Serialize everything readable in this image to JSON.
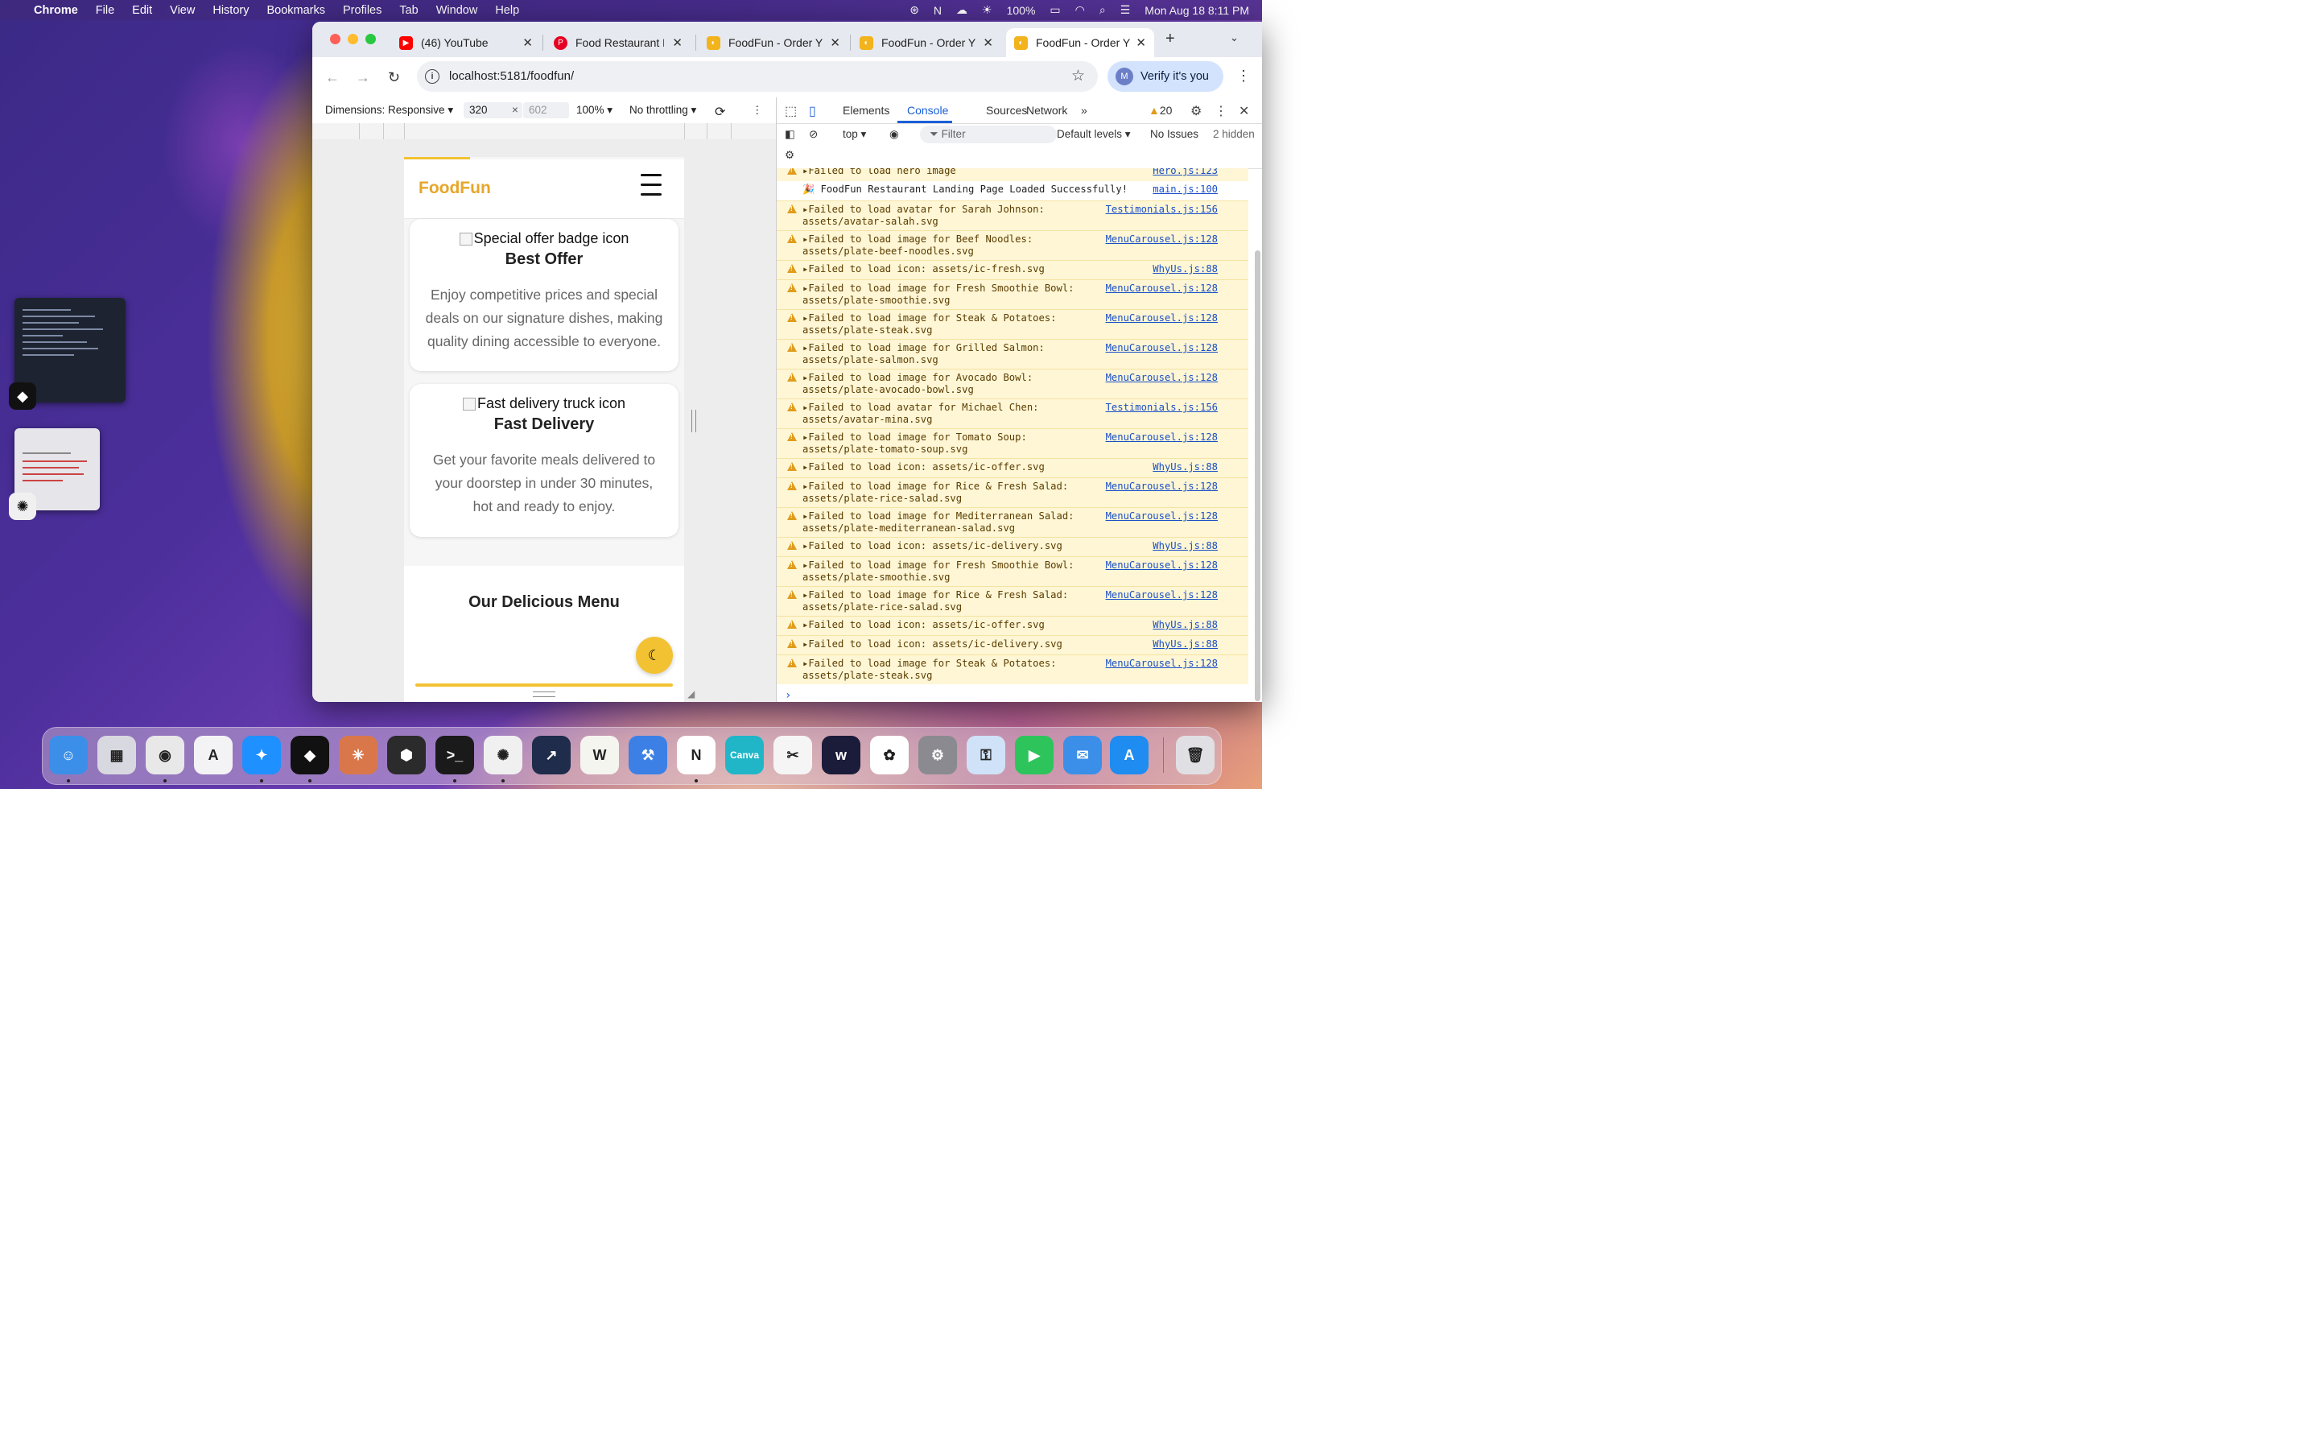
{
  "menubar": {
    "app": "Chrome",
    "items": [
      "File",
      "Edit",
      "View",
      "History",
      "Bookmarks",
      "Profiles",
      "Tab",
      "Window",
      "Help"
    ],
    "battery": "100%",
    "datetime": "Mon Aug 18  8:11 PM"
  },
  "tabs": [
    {
      "title": "(46) YouTube",
      "icon": "youtube-icon",
      "color": "#ff0000"
    },
    {
      "title": "Food Restaurant P",
      "icon": "pinterest-icon",
      "color": "#e60023"
    },
    {
      "title": "FoodFun - Order Y",
      "icon": "foodfun-icon",
      "color": "#f2b31c"
    },
    {
      "title": "FoodFun - Order Y",
      "icon": "foodfun-icon",
      "color": "#f2b31c"
    },
    {
      "title": "FoodFun - Order Y",
      "icon": "foodfun-icon",
      "color": "#f2b31c"
    }
  ],
  "address": {
    "url": "localhost:5181/foodfun/"
  },
  "profile": {
    "initial": "M",
    "label": "Verify it's you"
  },
  "device_toolbar": {
    "dimensions": "Dimensions: Responsive",
    "width": "320",
    "height": "602",
    "zoom": "100%",
    "throttling": "No throttling"
  },
  "page": {
    "logo": "FoodFun",
    "cards": [
      {
        "alt": "Special offer badge icon",
        "title": "Best Offer",
        "text": "Enjoy competitive prices and special deals on our signature dishes, making quality dining accessible to everyone."
      },
      {
        "alt": "Fast delivery truck icon",
        "title": "Fast Delivery",
        "text": "Get your favorite meals delivered to your doorstep in under 30 minutes, hot and ready to enjoy."
      }
    ],
    "menu_heading": "Our Delicious Menu"
  },
  "devtools": {
    "tabs": [
      "Elements",
      "Console",
      "Sources",
      "Network"
    ],
    "active_tab": "Console",
    "warning_count": "20",
    "context": "top",
    "filter_placeholder": "Filter",
    "levels": "Default levels",
    "issues": "No Issues",
    "hidden": "2 hidden"
  },
  "console": [
    {
      "type": "warn",
      "msg": "Failed to load hero image",
      "src": "Hero.js:123",
      "partial": true
    },
    {
      "type": "info",
      "msg": "🎉 FoodFun Restaurant Landing Page Loaded Successfully!",
      "src": "main.js:100"
    },
    {
      "type": "warn",
      "msg": "Failed to load avatar for Sarah Johnson:\nassets/avatar-salah.svg",
      "src": "Testimonials.js:156"
    },
    {
      "type": "warn",
      "msg": "Failed to load image for Beef Noodles:\nassets/plate-beef-noodles.svg",
      "src": "MenuCarousel.js:128"
    },
    {
      "type": "warn",
      "msg": "Failed to load icon: assets/ic-fresh.svg",
      "src": "WhyUs.js:88"
    },
    {
      "type": "warn",
      "msg": "Failed to load image for Fresh Smoothie Bowl:\nassets/plate-smoothie.svg",
      "src": "MenuCarousel.js:128"
    },
    {
      "type": "warn",
      "msg": "Failed to load image for Steak & Potatoes:\nassets/plate-steak.svg",
      "src": "MenuCarousel.js:128"
    },
    {
      "type": "warn",
      "msg": "Failed to load image for Grilled Salmon:\nassets/plate-salmon.svg",
      "src": "MenuCarousel.js:128"
    },
    {
      "type": "warn",
      "msg": "Failed to load image for Avocado Bowl:\nassets/plate-avocado-bowl.svg",
      "src": "MenuCarousel.js:128"
    },
    {
      "type": "warn",
      "msg": "Failed to load avatar for Michael Chen:\nassets/avatar-mina.svg",
      "src": "Testimonials.js:156"
    },
    {
      "type": "warn",
      "msg": "Failed to load image for Tomato Soup:\nassets/plate-tomato-soup.svg",
      "src": "MenuCarousel.js:128"
    },
    {
      "type": "warn",
      "msg": "Failed to load icon: assets/ic-offer.svg",
      "src": "WhyUs.js:88"
    },
    {
      "type": "warn",
      "msg": "Failed to load image for Rice & Fresh Salad:\nassets/plate-rice-salad.svg",
      "src": "MenuCarousel.js:128"
    },
    {
      "type": "warn",
      "msg": "Failed to load image for Mediterranean Salad:\nassets/plate-mediterranean-salad.svg",
      "src": "MenuCarousel.js:128"
    },
    {
      "type": "warn",
      "msg": "Failed to load icon: assets/ic-delivery.svg",
      "src": "WhyUs.js:88"
    },
    {
      "type": "warn",
      "msg": "Failed to load image for Fresh Smoothie Bowl:\nassets/plate-smoothie.svg",
      "src": "MenuCarousel.js:128"
    },
    {
      "type": "warn",
      "msg": "Failed to load image for Rice & Fresh Salad:\nassets/plate-rice-salad.svg",
      "src": "MenuCarousel.js:128"
    },
    {
      "type": "warn",
      "msg": "Failed to load icon: assets/ic-offer.svg",
      "src": "WhyUs.js:88"
    },
    {
      "type": "warn",
      "msg": "Failed to load icon: assets/ic-delivery.svg",
      "src": "WhyUs.js:88"
    },
    {
      "type": "warn",
      "msg": "Failed to load image for Steak & Potatoes:\nassets/plate-steak.svg",
      "src": "MenuCarousel.js:128"
    }
  ],
  "dock": [
    {
      "name": "finder-icon",
      "color": "#3b8fe8",
      "glyph": "☺",
      "dot": true
    },
    {
      "name": "launchpad-icon",
      "color": "#d8d8e0",
      "glyph": "▦",
      "dot": false
    },
    {
      "name": "chrome-icon",
      "color": "#e8e8e8",
      "glyph": "◉",
      "dot": true
    },
    {
      "name": "affinity-icon",
      "color": "#f3f3f6",
      "glyph": "A",
      "dot": false
    },
    {
      "name": "safari-icon",
      "color": "#1e90ff",
      "glyph": "✦",
      "dot": true
    },
    {
      "name": "cube-app-icon",
      "color": "#111111",
      "glyph": "◆",
      "dot": true
    },
    {
      "name": "claude-icon",
      "color": "#d9774b",
      "glyph": "✳",
      "dot": false
    },
    {
      "name": "3d-box-icon",
      "color": "#2b2b2b",
      "glyph": "⬢",
      "dot": false
    },
    {
      "name": "terminal-icon",
      "color": "#1a1a1a",
      "glyph": ">_",
      "dot": true
    },
    {
      "name": "chatgpt-icon",
      "color": "#f0f0f0",
      "glyph": "✺",
      "dot": true
    },
    {
      "name": "devtool-icon",
      "color": "#1f2c4c",
      "glyph": "↗",
      "dot": false
    },
    {
      "name": "writer-icon",
      "color": "#f5f5f0",
      "glyph": "W",
      "dot": false
    },
    {
      "name": "xcode-icon",
      "color": "#3c80e6",
      "glyph": "⚒",
      "dot": false
    },
    {
      "name": "notion-icon",
      "color": "#ffffff",
      "glyph": "N",
      "dot": true
    },
    {
      "name": "canva-icon",
      "color": "#20b6c8",
      "glyph": "Canva",
      "dot": false
    },
    {
      "name": "capcut-icon",
      "color": "#f5f5f5",
      "glyph": "✂",
      "dot": false
    },
    {
      "name": "webflow-icon",
      "color": "#1b1b3a",
      "glyph": "w",
      "dot": false
    },
    {
      "name": "photos-icon",
      "color": "#ffffff",
      "glyph": "✿",
      "dot": false
    },
    {
      "name": "system-settings-icon",
      "color": "#8a8a90",
      "glyph": "⚙",
      "dot": false
    },
    {
      "name": "keychain-icon",
      "color": "#cfe2f7",
      "glyph": "⚿",
      "dot": false
    },
    {
      "name": "facetime-icon",
      "color": "#2ec45c",
      "glyph": "▶",
      "dot": false
    },
    {
      "name": "mail-icon",
      "color": "#3b8fe8",
      "glyph": "✉",
      "dot": false
    },
    {
      "name": "app-store-icon",
      "color": "#1e8cf0",
      "glyph": "A",
      "dot": false
    },
    {
      "name": "trash-icon",
      "color": "#e0e0e4",
      "glyph": "🗑",
      "dot": false
    }
  ]
}
